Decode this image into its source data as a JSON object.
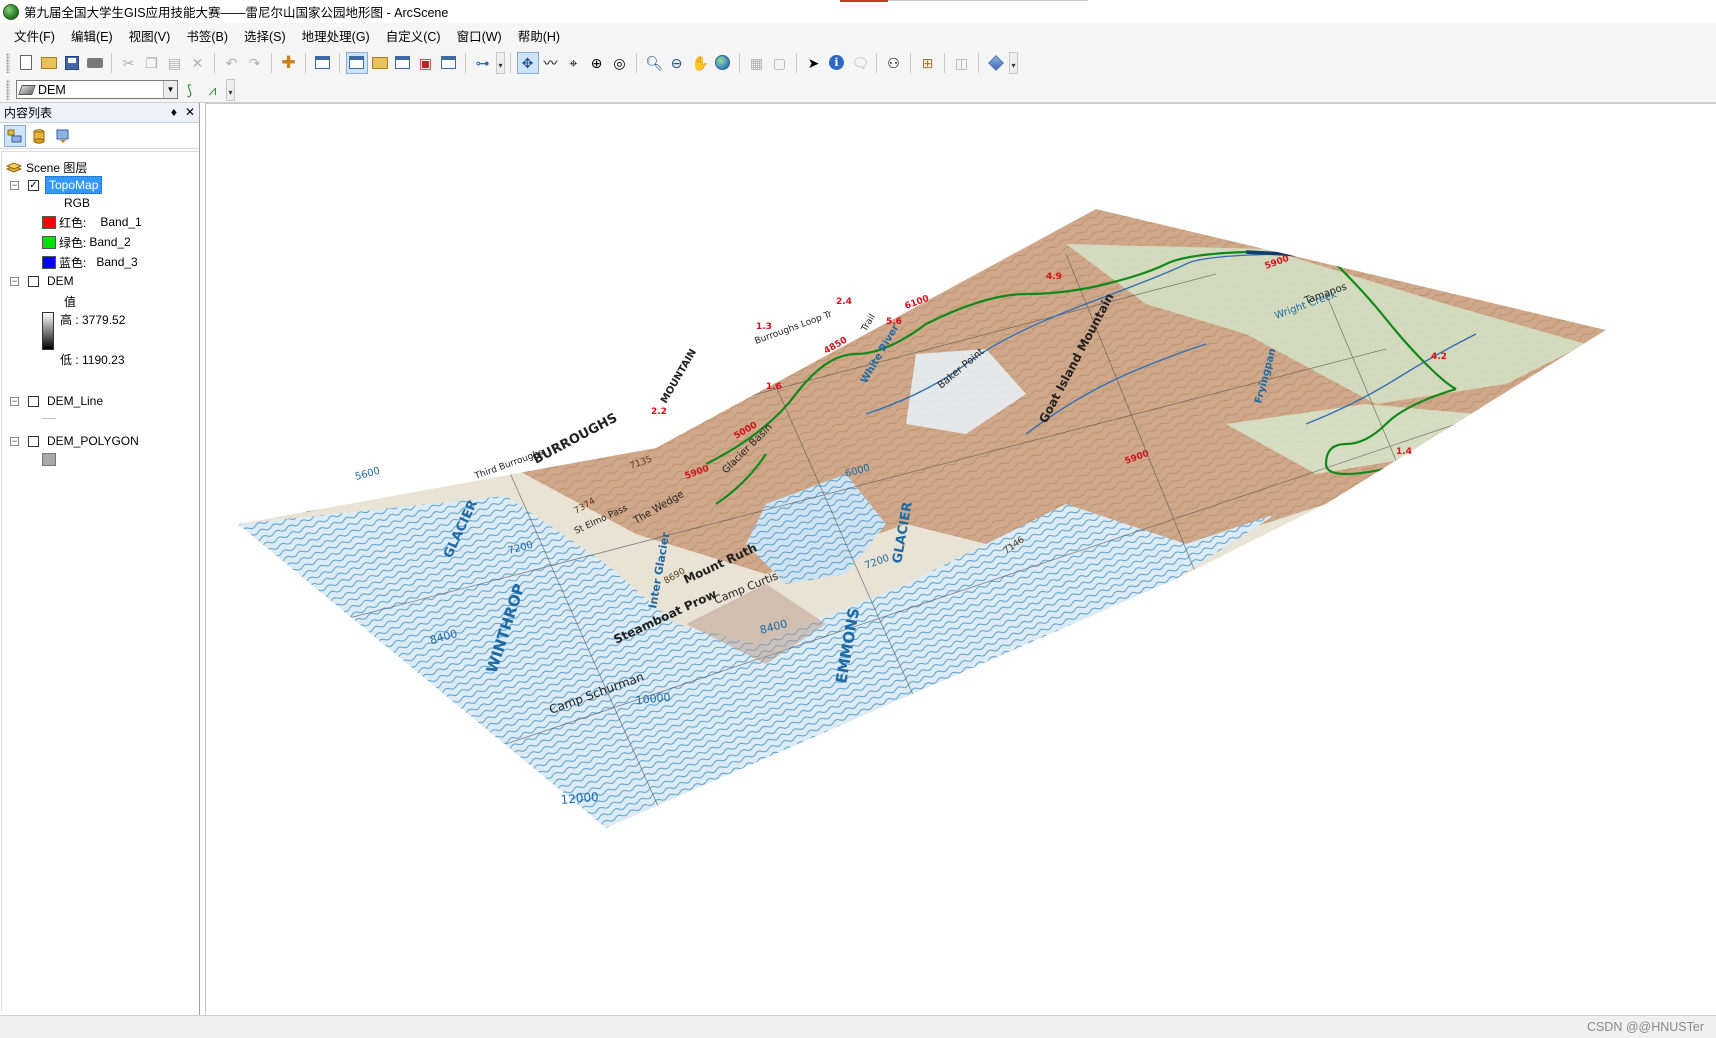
{
  "window": {
    "title": "第九届全国大学生GIS应用技能大赛——雷尼尔山国家公园地形图 - ArcScene"
  },
  "menu": [
    "文件(F)",
    "编辑(E)",
    "视图(V)",
    "书签(B)",
    "选择(S)",
    "地理处理(G)",
    "自定义(C)",
    "窗口(W)",
    "帮助(H)"
  ],
  "layer_toolbar": {
    "selected_layer": "DEM"
  },
  "toc": {
    "header": "内容列表",
    "pin": "♦",
    "close": "✕",
    "scene_label": "Scene 图层",
    "layers": [
      {
        "name": "TopoMap",
        "checked": true,
        "renderer": "RGB",
        "bands": [
          {
            "label": "红色:",
            "band": "Band_1",
            "color": "#ff0000"
          },
          {
            "label": "绿色:",
            "band": "Band_2",
            "color": "#00e000"
          },
          {
            "label": "蓝色:",
            "band": "Band_3",
            "color": "#0000ff"
          }
        ]
      },
      {
        "name": "DEM",
        "checked": false,
        "value_label": "值",
        "high_label": "高 : 3779.52",
        "low_label": "低 : 1190.23"
      },
      {
        "name": "DEM_Line",
        "checked": false
      },
      {
        "name": "DEM_POLYGON",
        "checked": false,
        "fill_color": "#a8a8a8"
      }
    ]
  },
  "map": {
    "labels": [
      {
        "text": "WINTHROP",
        "kind": "glacier"
      },
      {
        "text": "GLACIER",
        "kind": "glacier"
      },
      {
        "text": "EMMONS",
        "kind": "glacier"
      },
      {
        "text": "GLACIER",
        "kind": "glacier"
      },
      {
        "text": "Inter Glacier",
        "kind": "glacier"
      },
      {
        "text": "BURROUGHS",
        "kind": "terrain"
      },
      {
        "text": "MOUNTAIN",
        "kind": "terrain"
      },
      {
        "text": "Goat Island Mountain",
        "kind": "terrain"
      },
      {
        "text": "Mount Ruth",
        "kind": "terrain"
      },
      {
        "text": "Steamboat Prow",
        "kind": "terrain"
      },
      {
        "text": "Camp Schurman",
        "kind": "terrain"
      },
      {
        "text": "Camp Curtis",
        "kind": "terrain"
      },
      {
        "text": "Glacier Basin",
        "kind": "terrain"
      },
      {
        "text": "The Wedge",
        "kind": "terrain"
      },
      {
        "text": "St Elmo Pass",
        "kind": "terrain"
      },
      {
        "text": "Baker Point",
        "kind": "terrain"
      },
      {
        "text": "White River",
        "kind": "river"
      },
      {
        "text": "Fryingpan",
        "kind": "river"
      },
      {
        "text": "Wright Creek",
        "kind": "river"
      },
      {
        "text": "Tamanos",
        "kind": "terrain"
      },
      {
        "text": "Third Burroughs",
        "kind": "terrain"
      },
      {
        "text": "Burroughs Loop Tr",
        "kind": "trail"
      },
      {
        "text": "Trail",
        "kind": "trail"
      }
    ],
    "contours": [
      "5600",
      "7200",
      "8400",
      "10000",
      "12000",
      "8400",
      "7200",
      "6000",
      "7146",
      "7135",
      "7374",
      "8690"
    ],
    "trail_marks": [
      "1.3",
      "2.4",
      "2.2",
      "1.6",
      "4.2",
      "1.4",
      "5.6",
      "4.9"
    ],
    "elevation_marks": [
      "5900",
      "4850",
      "5000",
      "5900",
      "6100",
      "5900"
    ]
  },
  "watermark": "CSDN @@HNUSTer"
}
